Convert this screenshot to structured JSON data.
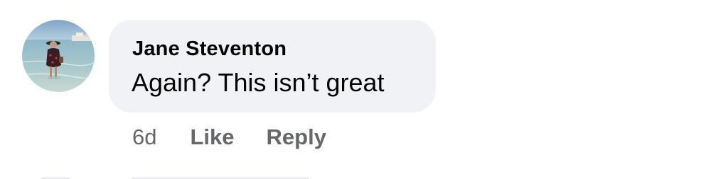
{
  "comment": {
    "author": "Jane Steventon",
    "text": "Again? This isn’t great",
    "timestamp": "6d",
    "actions": {
      "like_label": "Like",
      "reply_label": "Reply"
    }
  },
  "colors": {
    "bubble_bg": "#f0f2f5",
    "text": "#050505",
    "secondary_text": "#65676b"
  }
}
